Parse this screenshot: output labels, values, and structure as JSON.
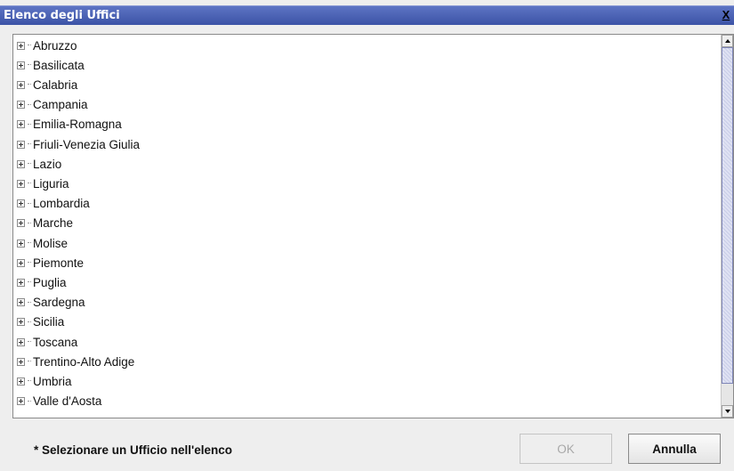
{
  "window": {
    "title": "Elenco degli Uffici",
    "close_label": "X"
  },
  "tree": {
    "items": [
      {
        "label": "Abruzzo"
      },
      {
        "label": "Basilicata"
      },
      {
        "label": "Calabria"
      },
      {
        "label": "Campania"
      },
      {
        "label": "Emilia-Romagna"
      },
      {
        "label": "Friuli-Venezia Giulia"
      },
      {
        "label": "Lazio"
      },
      {
        "label": "Liguria"
      },
      {
        "label": "Lombardia"
      },
      {
        "label": "Marche"
      },
      {
        "label": "Molise"
      },
      {
        "label": "Piemonte"
      },
      {
        "label": "Puglia"
      },
      {
        "label": "Sardegna"
      },
      {
        "label": "Sicilia"
      },
      {
        "label": "Toscana"
      },
      {
        "label": "Trentino-Alto Adige"
      },
      {
        "label": "Umbria"
      },
      {
        "label": "Valle d'Aosta"
      }
    ],
    "expander_icon": "plus-box-icon"
  },
  "footer": {
    "note": "* Selezionare un Ufficio nell'elenco",
    "ok_label": "OK",
    "cancel_label": "Annulla"
  },
  "colors": {
    "titlebar": "#3c53a6",
    "disabled_text": "#a8a8a8"
  }
}
